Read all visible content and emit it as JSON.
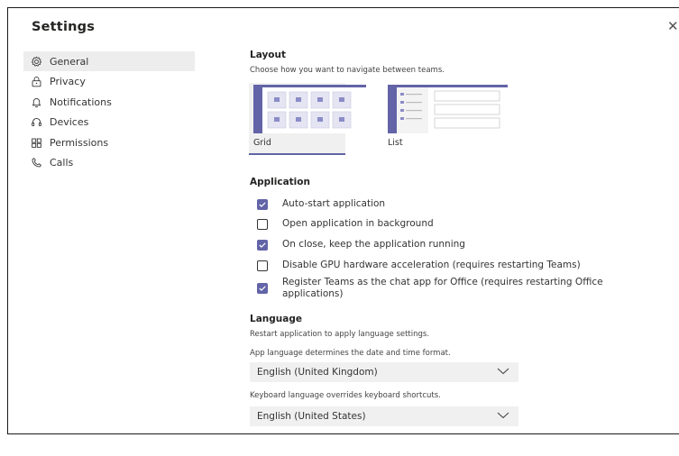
{
  "window": {
    "title": "Settings",
    "close_glyph": "✕"
  },
  "sidebar": {
    "items": [
      {
        "label": "General",
        "icon": "gear-icon",
        "active": true
      },
      {
        "label": "Privacy",
        "icon": "lock-icon",
        "active": false
      },
      {
        "label": "Notifications",
        "icon": "bell-icon",
        "active": false
      },
      {
        "label": "Devices",
        "icon": "headset-icon",
        "active": false
      },
      {
        "label": "Permissions",
        "icon": "permissions-icon",
        "active": false
      },
      {
        "label": "Calls",
        "icon": "phone-icon",
        "active": false
      }
    ]
  },
  "layout": {
    "title": "Layout",
    "description": "Choose how you want to navigate between teams.",
    "options": [
      {
        "label": "Grid",
        "selected": true
      },
      {
        "label": "List",
        "selected": false
      }
    ]
  },
  "application": {
    "title": "Application",
    "options": [
      {
        "label": "Auto-start application",
        "checked": true
      },
      {
        "label": "Open application in background",
        "checked": false
      },
      {
        "label": "On close, keep the application running",
        "checked": true
      },
      {
        "label": "Disable GPU hardware acceleration (requires restarting Teams)",
        "checked": false
      },
      {
        "label": "Register Teams as the chat app for Office (requires restarting Office applications)",
        "checked": true
      }
    ]
  },
  "language": {
    "title": "Language",
    "description": "Restart application to apply language settings.",
    "app_language_desc": "App language determines the date and time format.",
    "app_language_value": "English (United Kingdom)",
    "keyboard_language_desc": "Keyboard language overrides keyboard shortcuts.",
    "keyboard_language_value": "English (United States)"
  },
  "colors": {
    "accent": "#6264a7",
    "selected_bg": "#f0f0f0"
  }
}
